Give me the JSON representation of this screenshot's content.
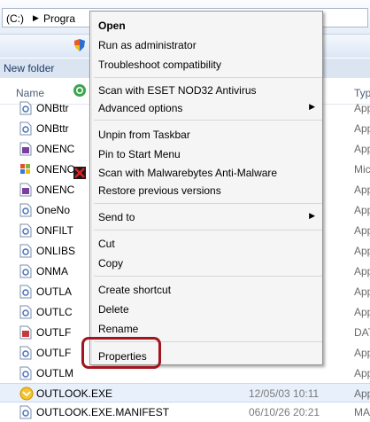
{
  "address": {
    "drive": "(C:)",
    "path": "Progra"
  },
  "toolbar": {
    "new_folder": "New folder"
  },
  "columns": {
    "name": "Name",
    "type": "Typ"
  },
  "files": [
    {
      "name": "ONBttr",
      "date": "",
      "type": "App",
      "icon": "app-icon"
    },
    {
      "name": "ONBttr",
      "date": "",
      "type": "App",
      "icon": "app-icon"
    },
    {
      "name": "ONENC",
      "date": "",
      "type": "App",
      "icon": "onenote-icon"
    },
    {
      "name": "ONENC",
      "date": "",
      "type": "Mic",
      "icon": "office-icon"
    },
    {
      "name": "ONENC",
      "date": "",
      "type": "App",
      "icon": "onenote-icon"
    },
    {
      "name": "OneNo",
      "date": "",
      "type": "App",
      "icon": "app-icon"
    },
    {
      "name": "ONFILT",
      "date": "",
      "type": "App",
      "icon": "app-icon"
    },
    {
      "name": "ONLIBS",
      "date": "",
      "type": "App",
      "icon": "app-icon"
    },
    {
      "name": "ONMA",
      "date": "",
      "type": "App",
      "icon": "app-icon"
    },
    {
      "name": "OUTLA",
      "date": "",
      "type": "App",
      "icon": "app-icon"
    },
    {
      "name": "OUTLC",
      "date": "",
      "type": "App",
      "icon": "app-icon"
    },
    {
      "name": "OUTLF",
      "date": "",
      "type": "DAT",
      "icon": "data-icon"
    },
    {
      "name": "OUTLF",
      "date": "",
      "type": "App",
      "icon": "app-icon"
    },
    {
      "name": "OUTLM",
      "date": "",
      "type": "App",
      "icon": "app-icon"
    },
    {
      "name": "OUTLOOK.EXE",
      "date": "12/05/03 10:11",
      "type": "App",
      "icon": "outlook-icon",
      "selected": true
    },
    {
      "name": "OUTLOOK.EXE.MANIFEST",
      "date": "06/10/26 20:21",
      "type": "MA",
      "icon": "app-icon"
    }
  ],
  "menu": {
    "open": "Open",
    "run_admin": "Run as administrator",
    "troubleshoot": "Troubleshoot compatibility",
    "scan_eset": "Scan with ESET NOD32 Antivirus",
    "advanced": "Advanced options",
    "unpin": "Unpin from Taskbar",
    "pin_start": "Pin to Start Menu",
    "scan_mbam": "Scan with Malwarebytes Anti-Malware",
    "restore": "Restore previous versions",
    "send_to": "Send to",
    "cut": "Cut",
    "copy": "Copy",
    "create_shortcut": "Create shortcut",
    "delete": "Delete",
    "rename": "Rename",
    "properties": "Properties"
  },
  "highlight_color": "#a1151f"
}
